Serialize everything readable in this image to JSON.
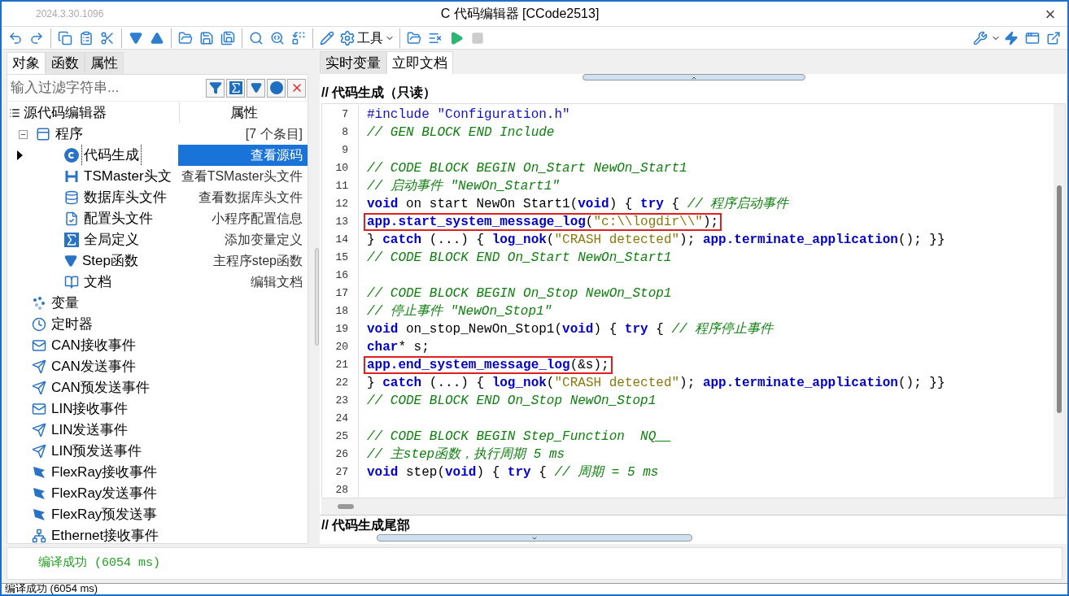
{
  "window": {
    "version": "2024.3.30.1096",
    "title": "C 代码编辑器 [CCode2513]",
    "close": "×"
  },
  "toolbar": {
    "tools_label": "工具"
  },
  "left_tabs": [
    {
      "label": "对象",
      "selected": true
    },
    {
      "label": "函数",
      "selected": false
    },
    {
      "label": "属性",
      "selected": false
    }
  ],
  "filter": {
    "placeholder": "输入过滤字符串..."
  },
  "tree": {
    "columns": [
      "源代码编辑器",
      "属性"
    ],
    "items": [
      {
        "label": "程序",
        "kind": "program",
        "value": "[7 个条目]",
        "expanded": true,
        "selected": false,
        "children": [
          {
            "label": "代码生成",
            "kind": "c",
            "value": "查看源码",
            "selected": true
          },
          {
            "label": "TSMaster头文",
            "kind": "h",
            "value": "查看TSMaster头文件",
            "selected": false
          },
          {
            "label": "数据库头文件",
            "kind": "db",
            "value": "查看数据库头文件",
            "selected": false
          },
          {
            "label": "配置头文件",
            "kind": "config",
            "value": "小程序配置信息",
            "selected": false
          },
          {
            "label": "全局定义",
            "kind": "sigma",
            "value": "添加变量定义",
            "selected": false
          },
          {
            "label": "Step函数",
            "kind": "step",
            "value": "主程序step函数",
            "selected": false
          },
          {
            "label": "文档",
            "kind": "book",
            "value": "编辑文档",
            "selected": false
          }
        ]
      },
      {
        "label": "变量",
        "kind": "vars",
        "selected": false
      },
      {
        "label": "定时器",
        "kind": "timer",
        "selected": false
      },
      {
        "label": "CAN接收事件",
        "kind": "mail",
        "selected": false
      },
      {
        "label": "CAN发送事件",
        "kind": "send",
        "selected": false
      },
      {
        "label": "CAN预发送事件",
        "kind": "send",
        "selected": false
      },
      {
        "label": "LIN接收事件",
        "kind": "mail",
        "selected": false
      },
      {
        "label": "LIN发送事件",
        "kind": "send",
        "selected": false
      },
      {
        "label": "LIN预发送事件",
        "kind": "send",
        "selected": false
      },
      {
        "label": "FlexRay接收事件",
        "kind": "flexray",
        "selected": false
      },
      {
        "label": "FlexRay发送事件",
        "kind": "flexray",
        "selected": false
      },
      {
        "label": "FlexRay预发送事",
        "kind": "flexray",
        "selected": false
      },
      {
        "label": "Ethernet接收事件",
        "kind": "ethernet",
        "selected": false
      }
    ]
  },
  "right_tabs": [
    {
      "label": "实时变量",
      "selected": false
    },
    {
      "label": "立即文档",
      "selected": true
    }
  ],
  "editor": {
    "header": "// 代码生成（只读）",
    "footer": "// 代码生成尾部",
    "lines": [
      {
        "n": "7",
        "boxed": false,
        "tokens": [
          {
            "kind": "pp",
            "t": "#include "
          },
          {
            "kind": "pp",
            "t": "\"Configuration.h\""
          }
        ]
      },
      {
        "n": "8",
        "boxed": false,
        "tokens": [
          {
            "kind": "cm",
            "t": "// GEN BLOCK END Include"
          }
        ]
      },
      {
        "n": "9",
        "boxed": false
      },
      {
        "n": "10",
        "boxed": false,
        "tokens": [
          {
            "kind": "cm",
            "t": "// CODE BLOCK BEGIN On_Start NewOn_Start1"
          }
        ]
      },
      {
        "n": "11",
        "boxed": false,
        "tokens": [
          {
            "kind": "cm",
            "t": "// 启动事件 \"NewOn_Start1\""
          }
        ]
      },
      {
        "n": "12",
        "boxed": false,
        "tokens": [
          {
            "kind": "kw",
            "t": "void"
          },
          {
            "kind": "tx",
            "t": " on start NewOn Start1("
          },
          {
            "kind": "kw",
            "t": "void"
          },
          {
            "kind": "tx",
            "t": ") { "
          },
          {
            "kind": "kw",
            "t": "try"
          },
          {
            "kind": "tx",
            "t": " { "
          },
          {
            "kind": "cm",
            "t": "// 程序启动事件"
          }
        ]
      },
      {
        "n": "13",
        "boxed": true,
        "tokens": [
          {
            "kind": "fn",
            "t": "app.start_system_message_log"
          },
          {
            "kind": "tx",
            "t": "("
          },
          {
            "kind": "str",
            "t": "\"c:\\\\logdir\\\\\""
          },
          {
            "kind": "tx",
            "t": ");"
          }
        ]
      },
      {
        "n": "14",
        "boxed": false,
        "tokens": [
          {
            "kind": "tx",
            "t": "} "
          },
          {
            "kind": "kw",
            "t": "catch"
          },
          {
            "kind": "tx",
            "t": " (...) { "
          },
          {
            "kind": "fn",
            "t": "log_nok"
          },
          {
            "kind": "tx",
            "t": "("
          },
          {
            "kind": "str",
            "t": "\"CRASH detected\""
          },
          {
            "kind": "tx",
            "t": "); "
          },
          {
            "kind": "fn",
            "t": "app.terminate_application"
          },
          {
            "kind": "tx",
            "t": "(); }}"
          }
        ]
      },
      {
        "n": "15",
        "boxed": false,
        "tokens": [
          {
            "kind": "cm",
            "t": "// CODE BLOCK END On_Start NewOn_Start1"
          }
        ]
      },
      {
        "n": "16",
        "boxed": false
      },
      {
        "n": "17",
        "boxed": false,
        "tokens": [
          {
            "kind": "cm",
            "t": "// CODE BLOCK BEGIN On_Stop NewOn_Stop1"
          }
        ]
      },
      {
        "n": "18",
        "boxed": false,
        "tokens": [
          {
            "kind": "cm",
            "t": "// 停止事件 \"NewOn_Stop1\""
          }
        ]
      },
      {
        "n": "19",
        "boxed": false,
        "tokens": [
          {
            "kind": "kw",
            "t": "void"
          },
          {
            "kind": "tx",
            "t": " on_stop_NewOn_Stop1("
          },
          {
            "kind": "kw",
            "t": "void"
          },
          {
            "kind": "tx",
            "t": ") { "
          },
          {
            "kind": "kw",
            "t": "try"
          },
          {
            "kind": "tx",
            "t": " { "
          },
          {
            "kind": "cm",
            "t": "// 程序停止事件"
          }
        ]
      },
      {
        "n": "20",
        "boxed": false,
        "tokens": [
          {
            "kind": "kw",
            "t": "char"
          },
          {
            "kind": "tx",
            "t": "* s;"
          }
        ]
      },
      {
        "n": "21",
        "boxed": true,
        "tokens": [
          {
            "kind": "fn",
            "t": "app.end_system_message_log"
          },
          {
            "kind": "tx",
            "t": "(&s);"
          }
        ]
      },
      {
        "n": "22",
        "boxed": false,
        "tokens": [
          {
            "kind": "tx",
            "t": "} "
          },
          {
            "kind": "kw",
            "t": "catch"
          },
          {
            "kind": "tx",
            "t": " (...) { "
          },
          {
            "kind": "fn",
            "t": "log_nok"
          },
          {
            "kind": "tx",
            "t": "("
          },
          {
            "kind": "str",
            "t": "\"CRASH detected\""
          },
          {
            "kind": "tx",
            "t": "); "
          },
          {
            "kind": "fn",
            "t": "app.terminate_application"
          },
          {
            "kind": "tx",
            "t": "(); }}"
          }
        ]
      },
      {
        "n": "23",
        "boxed": false,
        "tokens": [
          {
            "kind": "cm",
            "t": "// CODE BLOCK END On_Stop NewOn_Stop1"
          }
        ]
      },
      {
        "n": "24",
        "boxed": false
      },
      {
        "n": "25",
        "boxed": false,
        "tokens": [
          {
            "kind": "cm",
            "t": "// CODE BLOCK BEGIN Step_Function  NQ__"
          }
        ]
      },
      {
        "n": "26",
        "boxed": false,
        "tokens": [
          {
            "kind": "cm",
            "t": "// 主step函数，执行周期 5 ms"
          }
        ]
      },
      {
        "n": "27",
        "boxed": false,
        "tokens": [
          {
            "kind": "kw",
            "t": "void"
          },
          {
            "kind": "tx",
            "t": " step("
          },
          {
            "kind": "kw",
            "t": "void"
          },
          {
            "kind": "tx",
            "t": ") { "
          },
          {
            "kind": "kw",
            "t": "try"
          },
          {
            "kind": "tx",
            "t": " { "
          },
          {
            "kind": "cm",
            "t": "// 周期 = 5 ms"
          }
        ]
      },
      {
        "n": "28",
        "boxed": false
      }
    ]
  },
  "output": {
    "message": "编译成功 (6054 ms)"
  },
  "status_bar": {
    "text": "编译成功 (6054 ms)"
  }
}
